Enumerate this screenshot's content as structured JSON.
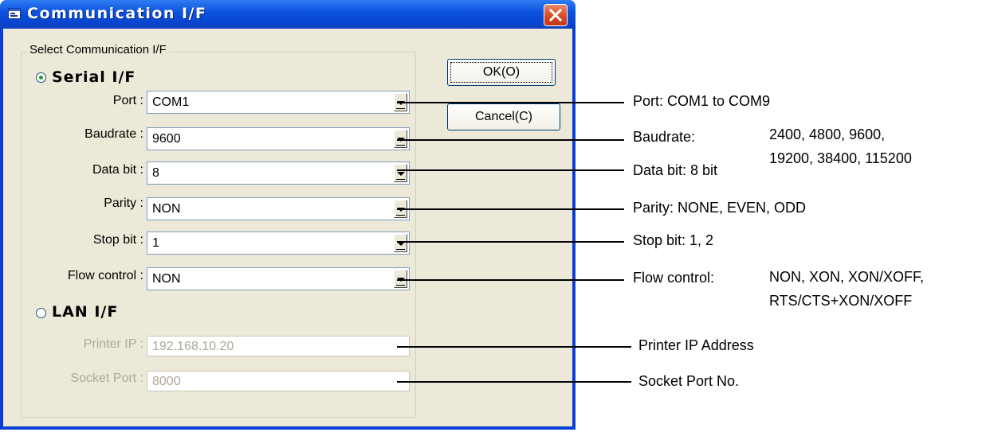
{
  "window": {
    "title": "Communication I/F",
    "title_icon": "app-window-icon",
    "close_icon": "close-icon"
  },
  "group": {
    "label": "Select Communication I/F"
  },
  "serial": {
    "label": "Serial I/F",
    "selected": true,
    "fields": [
      {
        "label": "Port :",
        "value": "COM1"
      },
      {
        "label": "Baudrate :",
        "value": "9600"
      },
      {
        "label": "Data bit :",
        "value": "8"
      },
      {
        "label": "Parity :",
        "value": "NON"
      },
      {
        "label": "Stop bit :",
        "value": "1"
      },
      {
        "label": "Flow control :",
        "value": "NON"
      }
    ]
  },
  "lan": {
    "label": "LAN I/F",
    "selected": false,
    "fields": [
      {
        "label": "Printer IP :",
        "value": "192.168.10.20"
      },
      {
        "label": "Socket Port :",
        "value": "8000"
      }
    ]
  },
  "buttons": {
    "ok": "OK(O)",
    "cancel": "Cancel(C)"
  },
  "annotations": {
    "port": "Port: COM1 to COM9",
    "baudrate": "Baudrate:",
    "baudrate_values_1": "2400, 4800, 9600,",
    "baudrate_values_2": "19200, 38400, 115200",
    "databit": "Data bit: 8 bit",
    "parity": "Parity: NONE, EVEN, ODD",
    "stopbit": "Stop bit: 1, 2",
    "flow": "Flow control:",
    "flow_values_1": "NON, XON, XON/XOFF,",
    "flow_values_2": "RTS/CTS+XON/XOFF",
    "printer_ip": "Printer IP Address",
    "socket_port": "Socket Port No."
  }
}
